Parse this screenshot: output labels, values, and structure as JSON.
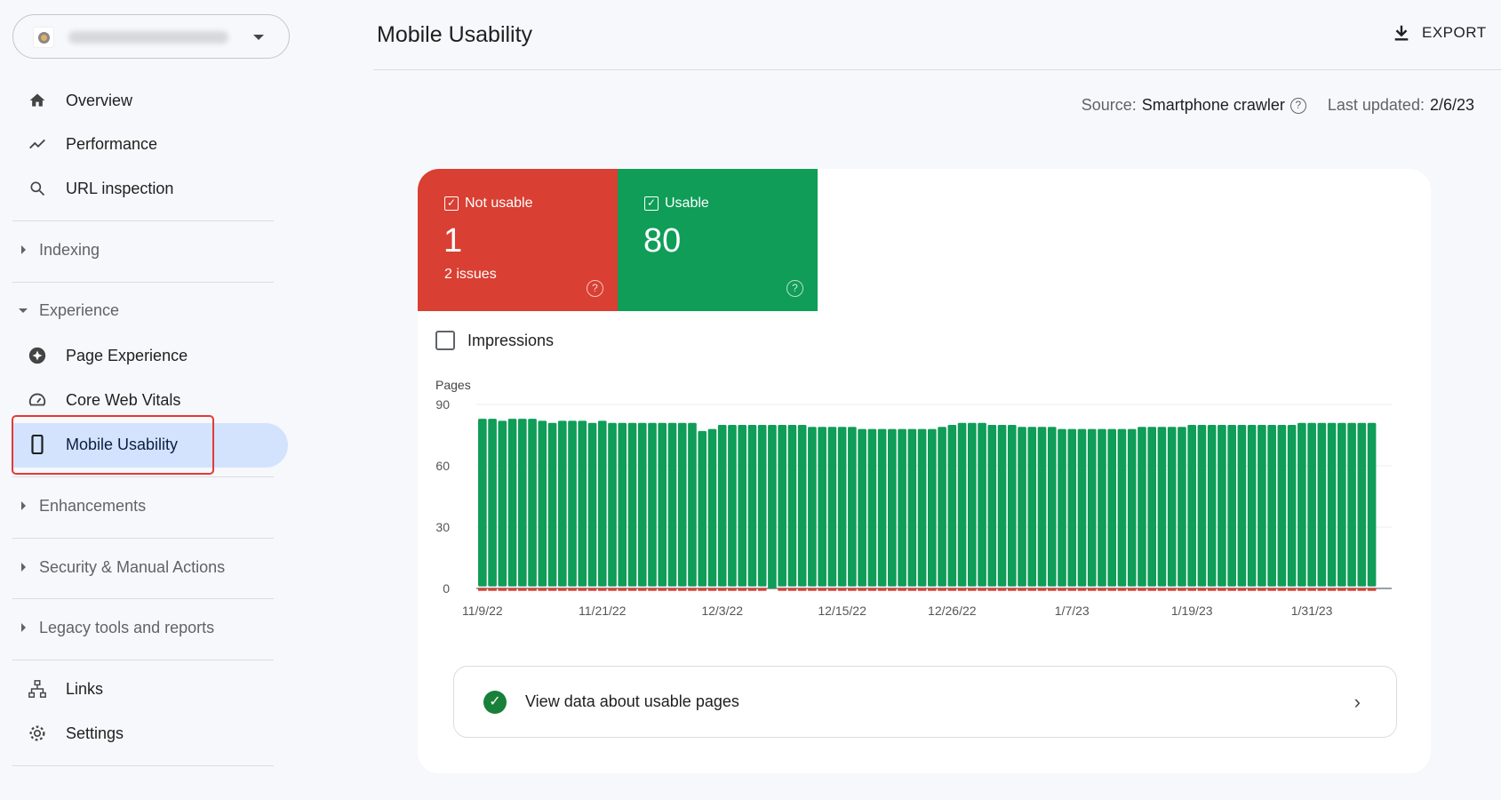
{
  "sidebar": {
    "property_selector": {
      "icon": "property-favicon"
    },
    "top_items": [
      {
        "label": "Overview",
        "icon": "home-icon"
      },
      {
        "label": "Performance",
        "icon": "trending-icon"
      },
      {
        "label": "URL inspection",
        "icon": "search-icon"
      }
    ],
    "sections": {
      "indexing": "Indexing",
      "experience": "Experience",
      "enhancements": "Enhancements",
      "security": "Security & Manual Actions",
      "legacy": "Legacy tools and reports"
    },
    "experience_items": [
      {
        "label": "Page Experience",
        "icon": "page-experience-icon"
      },
      {
        "label": "Core Web Vitals",
        "icon": "speedometer-icon"
      },
      {
        "label": "Mobile Usability",
        "icon": "smartphone-icon",
        "active": true
      }
    ],
    "bottom_items": [
      {
        "label": "Links",
        "icon": "sitemap-icon"
      },
      {
        "label": "Settings",
        "icon": "gear-icon"
      }
    ]
  },
  "header": {
    "title": "Mobile Usability",
    "export_label": "EXPORT"
  },
  "meta": {
    "source_label": "Source:",
    "source_value": "Smartphone crawler",
    "updated_label": "Last updated:",
    "updated_value": "2/6/23"
  },
  "tiles": {
    "not_usable": {
      "label": "Not usable",
      "value": "1",
      "sub": "2 issues",
      "color": "#d93f32"
    },
    "usable": {
      "label": "Usable",
      "value": "80",
      "color": "#0f9d58"
    }
  },
  "impressions_label": "Impressions",
  "view_link": "View data about usable pages",
  "chart_data": {
    "type": "bar",
    "stacked": true,
    "ylabel": "Pages",
    "ylim": [
      0,
      90
    ],
    "yticks": [
      0,
      30,
      60,
      90
    ],
    "grid": true,
    "xticks": [
      "11/9/22",
      "11/21/22",
      "12/3/22",
      "12/15/22",
      "12/26/22",
      "1/7/23",
      "1/19/23",
      "1/31/23"
    ],
    "categories": [
      "11/9/22",
      "11/10/22",
      "11/11/22",
      "11/12/22",
      "11/13/22",
      "11/14/22",
      "11/15/22",
      "11/16/22",
      "11/17/22",
      "11/18/22",
      "11/19/22",
      "11/20/22",
      "11/21/22",
      "11/22/22",
      "11/23/22",
      "11/24/22",
      "11/25/22",
      "11/26/22",
      "11/27/22",
      "11/28/22",
      "11/29/22",
      "11/30/22",
      "12/1/22",
      "12/2/22",
      "12/3/22",
      "12/4/22",
      "12/5/22",
      "12/6/22",
      "12/7/22",
      "12/8/22",
      "12/9/22",
      "12/10/22",
      "12/11/22",
      "12/12/22",
      "12/13/22",
      "12/14/22",
      "12/15/22",
      "12/16/22",
      "12/17/22",
      "12/18/22",
      "12/19/22",
      "12/20/22",
      "12/21/22",
      "12/22/22",
      "12/23/22",
      "12/24/22",
      "12/25/22",
      "12/26/22",
      "12/27/22",
      "12/28/22",
      "12/29/22",
      "12/30/22",
      "12/31/22",
      "1/1/23",
      "1/2/23",
      "1/3/23",
      "1/4/23",
      "1/5/23",
      "1/6/23",
      "1/7/23",
      "1/8/23",
      "1/9/23",
      "1/10/23",
      "1/11/23",
      "1/12/23",
      "1/13/23",
      "1/14/23",
      "1/15/23",
      "1/16/23",
      "1/17/23",
      "1/18/23",
      "1/19/23",
      "1/20/23",
      "1/21/23",
      "1/22/23",
      "1/23/23",
      "1/24/23",
      "1/25/23",
      "1/26/23",
      "1/27/23",
      "1/28/23",
      "1/29/23",
      "1/30/23",
      "1/31/23",
      "2/1/23",
      "2/2/23",
      "2/3/23",
      "2/4/23",
      "2/5/23",
      "2/6/23"
    ],
    "series": [
      {
        "name": "Not usable",
        "color": "#d93f32",
        "values": [
          1,
          1,
          1,
          1,
          1,
          1,
          1,
          1,
          1,
          1,
          1,
          1,
          1,
          1,
          1,
          1,
          1,
          1,
          1,
          1,
          1,
          1,
          1,
          1,
          1,
          1,
          1,
          1,
          1,
          0,
          1,
          1,
          1,
          1,
          1,
          1,
          1,
          1,
          1,
          1,
          1,
          1,
          1,
          1,
          1,
          1,
          1,
          1,
          1,
          1,
          1,
          1,
          1,
          1,
          1,
          1,
          1,
          1,
          1,
          1,
          1,
          1,
          1,
          1,
          1,
          1,
          1,
          1,
          1,
          1,
          1,
          1,
          1,
          1,
          1,
          1,
          1,
          1,
          1,
          1,
          1,
          1,
          1,
          1,
          1,
          1,
          1,
          1,
          1,
          1
        ]
      },
      {
        "name": "Usable",
        "color": "#0f9d58",
        "values": [
          82,
          82,
          81,
          82,
          82,
          82,
          81,
          80,
          81,
          81,
          81,
          80,
          81,
          80,
          80,
          80,
          80,
          80,
          80,
          80,
          80,
          80,
          76,
          77,
          79,
          79,
          79,
          79,
          79,
          80,
          79,
          79,
          79,
          78,
          78,
          78,
          78,
          78,
          77,
          77,
          77,
          77,
          77,
          77,
          77,
          77,
          78,
          79,
          80,
          80,
          80,
          79,
          79,
          79,
          78,
          78,
          78,
          78,
          77,
          77,
          77,
          77,
          77,
          77,
          77,
          77,
          78,
          78,
          78,
          78,
          78,
          79,
          79,
          79,
          79,
          79,
          79,
          79,
          79,
          79,
          79,
          79,
          80,
          80,
          80,
          80,
          80,
          80,
          80,
          80
        ]
      }
    ]
  }
}
